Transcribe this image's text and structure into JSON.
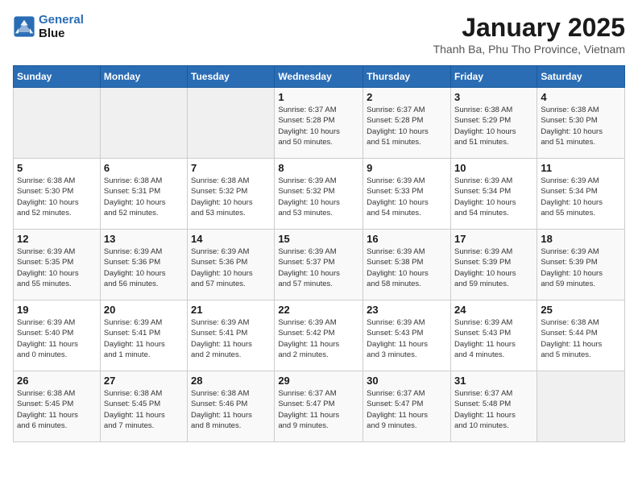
{
  "header": {
    "logo_line1": "General",
    "logo_line2": "Blue",
    "title": "January 2025",
    "subtitle": "Thanh Ba, Phu Tho Province, Vietnam"
  },
  "weekdays": [
    "Sunday",
    "Monday",
    "Tuesday",
    "Wednesday",
    "Thursday",
    "Friday",
    "Saturday"
  ],
  "weeks": [
    [
      {
        "day": "",
        "info": ""
      },
      {
        "day": "",
        "info": ""
      },
      {
        "day": "",
        "info": ""
      },
      {
        "day": "1",
        "info": "Sunrise: 6:37 AM\nSunset: 5:28 PM\nDaylight: 10 hours\nand 50 minutes."
      },
      {
        "day": "2",
        "info": "Sunrise: 6:37 AM\nSunset: 5:28 PM\nDaylight: 10 hours\nand 51 minutes."
      },
      {
        "day": "3",
        "info": "Sunrise: 6:38 AM\nSunset: 5:29 PM\nDaylight: 10 hours\nand 51 minutes."
      },
      {
        "day": "4",
        "info": "Sunrise: 6:38 AM\nSunset: 5:30 PM\nDaylight: 10 hours\nand 51 minutes."
      }
    ],
    [
      {
        "day": "5",
        "info": "Sunrise: 6:38 AM\nSunset: 5:30 PM\nDaylight: 10 hours\nand 52 minutes."
      },
      {
        "day": "6",
        "info": "Sunrise: 6:38 AM\nSunset: 5:31 PM\nDaylight: 10 hours\nand 52 minutes."
      },
      {
        "day": "7",
        "info": "Sunrise: 6:38 AM\nSunset: 5:32 PM\nDaylight: 10 hours\nand 53 minutes."
      },
      {
        "day": "8",
        "info": "Sunrise: 6:39 AM\nSunset: 5:32 PM\nDaylight: 10 hours\nand 53 minutes."
      },
      {
        "day": "9",
        "info": "Sunrise: 6:39 AM\nSunset: 5:33 PM\nDaylight: 10 hours\nand 54 minutes."
      },
      {
        "day": "10",
        "info": "Sunrise: 6:39 AM\nSunset: 5:34 PM\nDaylight: 10 hours\nand 54 minutes."
      },
      {
        "day": "11",
        "info": "Sunrise: 6:39 AM\nSunset: 5:34 PM\nDaylight: 10 hours\nand 55 minutes."
      }
    ],
    [
      {
        "day": "12",
        "info": "Sunrise: 6:39 AM\nSunset: 5:35 PM\nDaylight: 10 hours\nand 55 minutes."
      },
      {
        "day": "13",
        "info": "Sunrise: 6:39 AM\nSunset: 5:36 PM\nDaylight: 10 hours\nand 56 minutes."
      },
      {
        "day": "14",
        "info": "Sunrise: 6:39 AM\nSunset: 5:36 PM\nDaylight: 10 hours\nand 57 minutes."
      },
      {
        "day": "15",
        "info": "Sunrise: 6:39 AM\nSunset: 5:37 PM\nDaylight: 10 hours\nand 57 minutes."
      },
      {
        "day": "16",
        "info": "Sunrise: 6:39 AM\nSunset: 5:38 PM\nDaylight: 10 hours\nand 58 minutes."
      },
      {
        "day": "17",
        "info": "Sunrise: 6:39 AM\nSunset: 5:39 PM\nDaylight: 10 hours\nand 59 minutes."
      },
      {
        "day": "18",
        "info": "Sunrise: 6:39 AM\nSunset: 5:39 PM\nDaylight: 10 hours\nand 59 minutes."
      }
    ],
    [
      {
        "day": "19",
        "info": "Sunrise: 6:39 AM\nSunset: 5:40 PM\nDaylight: 11 hours\nand 0 minutes."
      },
      {
        "day": "20",
        "info": "Sunrise: 6:39 AM\nSunset: 5:41 PM\nDaylight: 11 hours\nand 1 minute."
      },
      {
        "day": "21",
        "info": "Sunrise: 6:39 AM\nSunset: 5:41 PM\nDaylight: 11 hours\nand 2 minutes."
      },
      {
        "day": "22",
        "info": "Sunrise: 6:39 AM\nSunset: 5:42 PM\nDaylight: 11 hours\nand 2 minutes."
      },
      {
        "day": "23",
        "info": "Sunrise: 6:39 AM\nSunset: 5:43 PM\nDaylight: 11 hours\nand 3 minutes."
      },
      {
        "day": "24",
        "info": "Sunrise: 6:39 AM\nSunset: 5:43 PM\nDaylight: 11 hours\nand 4 minutes."
      },
      {
        "day": "25",
        "info": "Sunrise: 6:38 AM\nSunset: 5:44 PM\nDaylight: 11 hours\nand 5 minutes."
      }
    ],
    [
      {
        "day": "26",
        "info": "Sunrise: 6:38 AM\nSunset: 5:45 PM\nDaylight: 11 hours\nand 6 minutes."
      },
      {
        "day": "27",
        "info": "Sunrise: 6:38 AM\nSunset: 5:45 PM\nDaylight: 11 hours\nand 7 minutes."
      },
      {
        "day": "28",
        "info": "Sunrise: 6:38 AM\nSunset: 5:46 PM\nDaylight: 11 hours\nand 8 minutes."
      },
      {
        "day": "29",
        "info": "Sunrise: 6:37 AM\nSunset: 5:47 PM\nDaylight: 11 hours\nand 9 minutes."
      },
      {
        "day": "30",
        "info": "Sunrise: 6:37 AM\nSunset: 5:47 PM\nDaylight: 11 hours\nand 9 minutes."
      },
      {
        "day": "31",
        "info": "Sunrise: 6:37 AM\nSunset: 5:48 PM\nDaylight: 11 hours\nand 10 minutes."
      },
      {
        "day": "",
        "info": ""
      }
    ]
  ]
}
